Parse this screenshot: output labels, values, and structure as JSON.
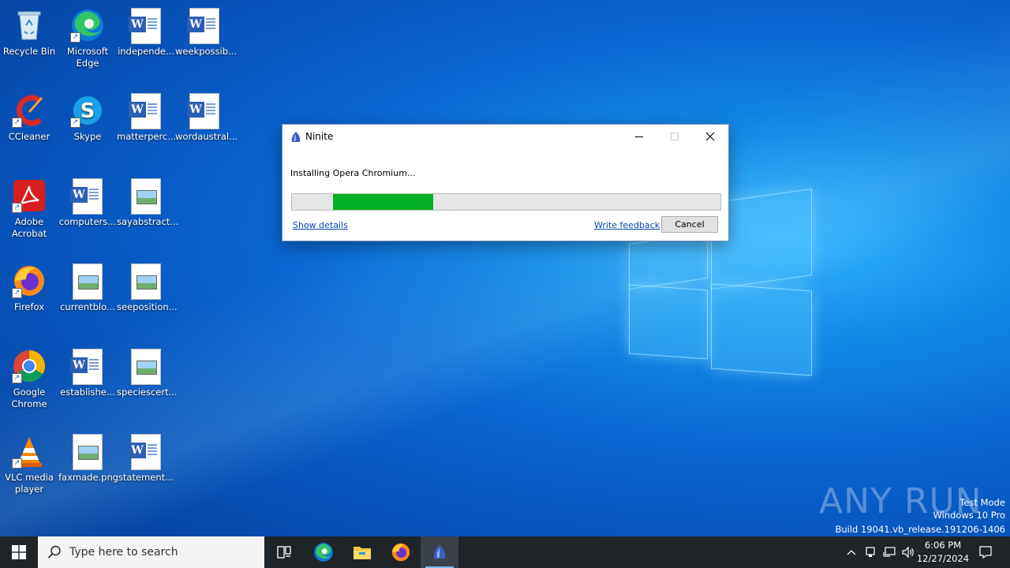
{
  "desktop": {
    "icons": [
      {
        "label": "Recycle Bin"
      },
      {
        "label": "Microsoft Edge"
      },
      {
        "label": "independe..."
      },
      {
        "label": "weekpossib..."
      },
      {
        "label": "CCleaner"
      },
      {
        "label": "Skype"
      },
      {
        "label": "matterperc..."
      },
      {
        "label": "wordaustral..."
      },
      {
        "label": "Adobe Acrobat"
      },
      {
        "label": "computers..."
      },
      {
        "label": "sayabstract..."
      },
      {
        "label": "Firefox"
      },
      {
        "label": "currentblo..."
      },
      {
        "label": "seeposition..."
      },
      {
        "label": "Google Chrome"
      },
      {
        "label": "establishe..."
      },
      {
        "label": "speciescert..."
      },
      {
        "label": "VLC media player"
      },
      {
        "label": "faxmade.png"
      },
      {
        "label": "statement..."
      }
    ]
  },
  "dialog": {
    "title": "Ninite",
    "status": "Installing Opera Chromium...",
    "progress": {
      "start_fraction": 0.096,
      "end_fraction": 0.33,
      "color": "#06b025"
    },
    "show_details": "Show details",
    "write_feedback": "Write feedback",
    "cancel": "Cancel"
  },
  "watermark": {
    "brand": "ANY RUN",
    "line1": "Test Mode",
    "line2": "Windows 10 Pro",
    "line3": "Build 19041.vb_release.191206-1406"
  },
  "taskbar": {
    "search_placeholder": "Type here to search",
    "time": "6:06 PM",
    "date": "12/27/2024"
  }
}
